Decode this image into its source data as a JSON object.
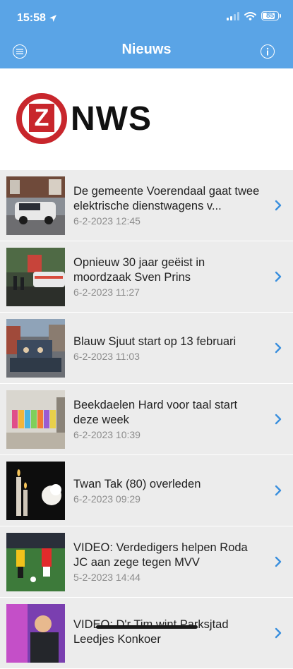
{
  "status_bar": {
    "time": "15:58",
    "battery": "85",
    "battery_level": 0.85
  },
  "nav": {
    "title": "Nieuws",
    "left_icon": "menu-icon",
    "right_icon": "info-icon"
  },
  "logo": {
    "letter": "Z",
    "text": "NWS"
  },
  "accent_color": "#5aa4e6",
  "brand_color": "#c8262c",
  "articles": [
    {
      "title": "De gemeente Voerendaal gaat twee elektrische dienstwagens v...",
      "date": "6-2-2023 12:45"
    },
    {
      "title": "Opnieuw 30 jaar geëist in moordzaak Sven Prins",
      "date": "6-2-2023 11:27"
    },
    {
      "title": "Blauw Sjuut start op  13 februari",
      "date": "6-2-2023 11:03"
    },
    {
      "title": "Beekdaelen Hard voor taal start deze week",
      "date": "6-2-2023 10:39"
    },
    {
      "title": "Twan Tak (80) overleden",
      "date": "6-2-2023 09:29"
    },
    {
      "title": "VIDEO: Verdedigers helpen Roda JC aan zege tegen MVV",
      "date": "5-2-2023 14:44"
    },
    {
      "title": "VIDEO: D'r Tim wint Parksjtad Leedjes Konkoer",
      "date": ""
    }
  ]
}
